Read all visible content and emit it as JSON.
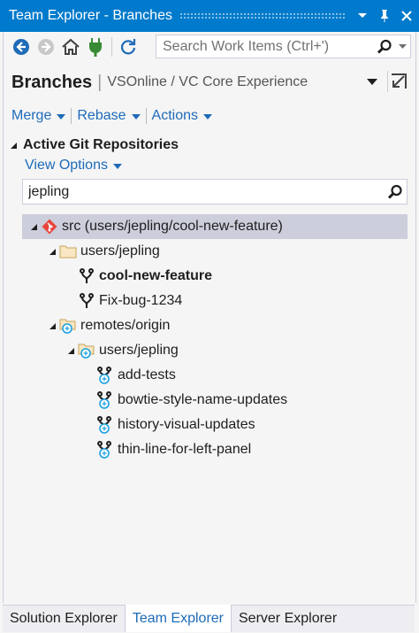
{
  "window": {
    "title": "Team Explorer - Branches"
  },
  "toolbar": {
    "search_placeholder": "Search Work Items (Ctrl+')"
  },
  "header": {
    "title": "Branches",
    "separator": "|",
    "subtitle": "VSOnline / VC Core Experience"
  },
  "actions": [
    {
      "label": "Merge"
    },
    {
      "label": "Rebase"
    },
    {
      "label": "Actions"
    }
  ],
  "section": {
    "title": "Active Git Repositories",
    "view_options": "View Options"
  },
  "filter": {
    "value": "jepling"
  },
  "tree": [
    {
      "label": "src (users/jepling/cool-new-feature)",
      "icon": "git-repo-icon",
      "indent": 0,
      "expander": "expanded",
      "selected": true,
      "bold": false
    },
    {
      "label": "users/jepling",
      "icon": "folder-icon",
      "indent": 1,
      "expander": "expanded",
      "selected": false,
      "bold": false
    },
    {
      "label": "cool-new-feature",
      "icon": "branch-icon",
      "indent": 2,
      "expander": "none",
      "selected": false,
      "bold": true
    },
    {
      "label": "Fix-bug-1234",
      "icon": "branch-icon",
      "indent": 2,
      "expander": "none",
      "selected": false,
      "bold": false
    },
    {
      "label": "remotes/origin",
      "icon": "remote-folder-icon",
      "indent": 1,
      "expander": "expanded",
      "selected": false,
      "bold": false
    },
    {
      "label": "users/jepling",
      "icon": "remote-folder-icon",
      "indent": 2,
      "expander": "expanded",
      "selected": false,
      "bold": false
    },
    {
      "label": "add-tests",
      "icon": "remote-branch-icon",
      "indent": 3,
      "expander": "none",
      "selected": false,
      "bold": false
    },
    {
      "label": "bowtie-style-name-updates",
      "icon": "remote-branch-icon",
      "indent": 3,
      "expander": "none",
      "selected": false,
      "bold": false
    },
    {
      "label": "history-visual-updates",
      "icon": "remote-branch-icon",
      "indent": 3,
      "expander": "none",
      "selected": false,
      "bold": false
    },
    {
      "label": "thin-line-for-left-panel",
      "icon": "remote-branch-icon",
      "indent": 3,
      "expander": "none",
      "selected": false,
      "bold": false
    }
  ],
  "bottom_tabs": [
    {
      "label": "Solution Explorer",
      "active": false
    },
    {
      "label": "Team Explorer",
      "active": true
    },
    {
      "label": "Server Explorer",
      "active": false
    }
  ],
  "colors": {
    "accent": "#007acc",
    "link": "#1e6bb8",
    "selection": "#cccedb",
    "git": "#e8453c",
    "plug": "#388a34",
    "folder": "#dcb67a",
    "remote": "#1ba1e2"
  }
}
